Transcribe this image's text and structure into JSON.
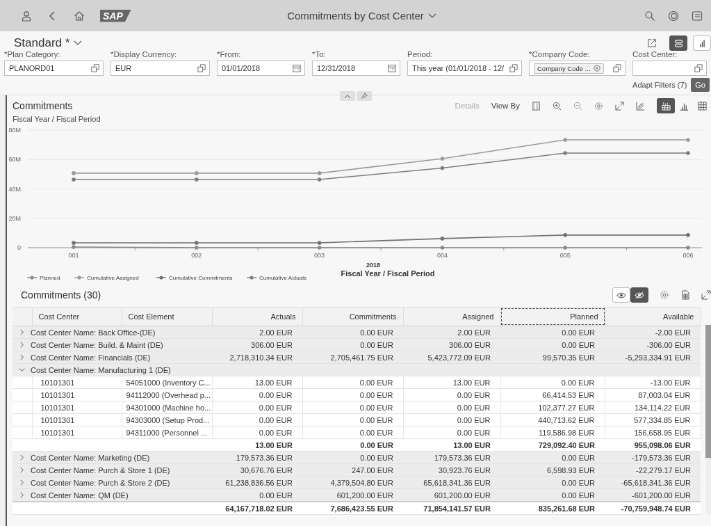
{
  "shell": {
    "logo": "SAP",
    "title": "Commitments by Cost Center"
  },
  "variant": {
    "name": "Standard *"
  },
  "view_toggle": [
    {
      "selected": true
    },
    {
      "selected": false
    }
  ],
  "filters": [
    {
      "label": "*Plan Category:",
      "kind": "valuehelp",
      "value": "PLANORD01"
    },
    {
      "label": "*Display Currency:",
      "kind": "valuehelp",
      "value": "EUR"
    },
    {
      "label": "*From:",
      "kind": "date",
      "value": "01/01/2018"
    },
    {
      "label": "*To:",
      "kind": "date",
      "value": "12/31/2018"
    },
    {
      "label": "Period:",
      "kind": "valuehelp",
      "value": "This year (01/01/2018 - 12/"
    },
    {
      "label": "*Company Code:",
      "kind": "token",
      "token": "Company Code ..."
    },
    {
      "label": "Cost Center:",
      "kind": "valuehelp"
    }
  ],
  "adapt_filters": "Adapt Filters (7)",
  "go": "Go",
  "chart_panel": {
    "title": "Commitments",
    "subtitle": "Fiscal Year / Fiscal Period",
    "details": {
      "label": "Details",
      "disabled": true
    },
    "view_by": "View By",
    "chart_types": [
      {
        "selected": true
      },
      {
        "selected": false
      },
      {
        "selected": false
      }
    ],
    "axis_group": "2018",
    "chart_data": {
      "type": "line",
      "grid": true,
      "legend": true,
      "xlabel": "Fiscal Year / Fiscal Period",
      "categories": [
        "001",
        "002",
        "003",
        "004",
        "005",
        "006"
      ],
      "ylim": [
        0,
        80000000
      ],
      "yticks": [
        {
          "value": 0,
          "label": "0"
        },
        {
          "value": 20000000,
          "label": "20M"
        },
        {
          "value": 40000000,
          "label": "40M"
        },
        {
          "value": 60000000,
          "label": "60M"
        },
        {
          "value": 80000000,
          "label": "80M"
        }
      ],
      "series": [
        {
          "name": "Planned",
          "color": "#8a8a8a",
          "values": [
            500000,
            0,
            0,
            0,
            0,
            0
          ]
        },
        {
          "name": "Cumulative Assigned",
          "color": "#9a9a9a",
          "values": [
            50700000,
            50700000,
            50700000,
            60600000,
            73400000,
            73400000
          ]
        },
        {
          "name": "Cumulative Commitments",
          "color": "#707070",
          "values": [
            3300000,
            3300000,
            3300000,
            6200000,
            8600000,
            8600000
          ]
        },
        {
          "name": "Cumulative Actuals",
          "color": "#7e7e7e",
          "values": [
            46400000,
            46400000,
            46400000,
            54200000,
            64400000,
            64400000
          ]
        }
      ]
    }
  },
  "table": {
    "title": "Commitments (30)",
    "detail_toggle": [
      {
        "selected": false
      },
      {
        "selected": true
      }
    ],
    "columns": [
      {
        "label": "Cost Center",
        "focused": false
      },
      {
        "label": "Cost Element",
        "focused": false
      },
      {
        "label": "Actuals",
        "focused": false
      },
      {
        "label": "Commitments",
        "focused": false
      },
      {
        "label": "Assigned",
        "focused": false
      },
      {
        "label": "Planned",
        "focused": true
      },
      {
        "label": "Available",
        "focused": false
      }
    ],
    "rows": [
      {
        "kind": "group",
        "expanded": false,
        "label": "Cost Center Name: Back Office-(DE)",
        "cells": [
          "2.00 EUR",
          "0.00 EUR",
          "2.00 EUR",
          "0.00 EUR",
          "-2.00 EUR"
        ]
      },
      {
        "kind": "group",
        "expanded": false,
        "label": "Cost Center Name: Build. & Maint (DE)",
        "cells": [
          "306.00 EUR",
          "0.00 EUR",
          "306.00 EUR",
          "0.00 EUR",
          "-306.00 EUR"
        ]
      },
      {
        "kind": "group",
        "expanded": false,
        "label": "Cost Center Name: Financials (DE)",
        "cells": [
          "2,718,310.34 EUR",
          "2,705,461.75 EUR",
          "5,423,772.09 EUR",
          "99,570.35 EUR",
          "-5,293,334.91 EUR"
        ]
      },
      {
        "kind": "group",
        "expanded": true,
        "label": "Cost Center Name: Manufacturing 1 (DE)"
      },
      {
        "kind": "item",
        "cost_center": "10101301",
        "cost_element": "54051000 (Inventory C...",
        "cells": [
          "13.00 EUR",
          "0.00 EUR",
          "13.00 EUR",
          "0.00 EUR",
          "-13.00 EUR"
        ]
      },
      {
        "kind": "item",
        "cost_center": "10101301",
        "cost_element": "94112000 (Overhead p...",
        "cells": [
          "0.00 EUR",
          "0.00 EUR",
          "0.00 EUR",
          "66,414.53 EUR",
          "87,003.04 EUR"
        ]
      },
      {
        "kind": "item",
        "cost_center": "10101301",
        "cost_element": "94301000 (Machine ho...",
        "cells": [
          "0.00 EUR",
          "0.00 EUR",
          "0.00 EUR",
          "102,377.27 EUR",
          "134,114.22 EUR"
        ]
      },
      {
        "kind": "item",
        "cost_center": "10101301",
        "cost_element": "94303000 (Setup Prod...",
        "cells": [
          "0.00 EUR",
          "0.00 EUR",
          "0.00 EUR",
          "440,713.62 EUR",
          "577,334.85 EUR"
        ]
      },
      {
        "kind": "item",
        "cost_center": "10101301",
        "cost_element": "94311000 (Personnel ...",
        "cells": [
          "0.00 EUR",
          "0.00 EUR",
          "0.00 EUR",
          "119,586.98 EUR",
          "156,658.95 EUR"
        ]
      },
      {
        "kind": "subtotal",
        "cells": [
          "13.00 EUR",
          "0.00 EUR",
          "13.00 EUR",
          "729,092.40 EUR",
          "955,098.06 EUR"
        ]
      },
      {
        "kind": "group",
        "expanded": false,
        "label": "Cost Center Name: Marketing (DE)",
        "cells": [
          "179,573.36 EUR",
          "0.00 EUR",
          "179,573.36 EUR",
          "0.00 EUR",
          "-179,573.36 EUR"
        ]
      },
      {
        "kind": "group",
        "expanded": false,
        "label": "Cost Center Name: Purch & Store 1 (DE)",
        "cells": [
          "30,676.76 EUR",
          "247.00 EUR",
          "30,923.76 EUR",
          "6,598.93 EUR",
          "-22,279.17 EUR"
        ]
      },
      {
        "kind": "group",
        "expanded": false,
        "label": "Cost Center Name: Purch & Store 2 (DE)",
        "cells": [
          "61,238,836.56 EUR",
          "4,379,504.80 EUR",
          "65,618,341.36 EUR",
          "0.00 EUR",
          "-65,618,341.36 EUR"
        ]
      },
      {
        "kind": "group",
        "expanded": false,
        "label": "Cost Center Name: QM (DE)",
        "cells": [
          "0.00 EUR",
          "601,200.00 EUR",
          "601,200.00 EUR",
          "0.00 EUR",
          "-601,200.00 EUR"
        ]
      },
      {
        "kind": "total",
        "cells": [
          "64,167,718.02 EUR",
          "7,686,423.55 EUR",
          "71,854,141.57 EUR",
          "835,261.68 EUR",
          "-70,759,948.74 EUR"
        ]
      }
    ]
  }
}
